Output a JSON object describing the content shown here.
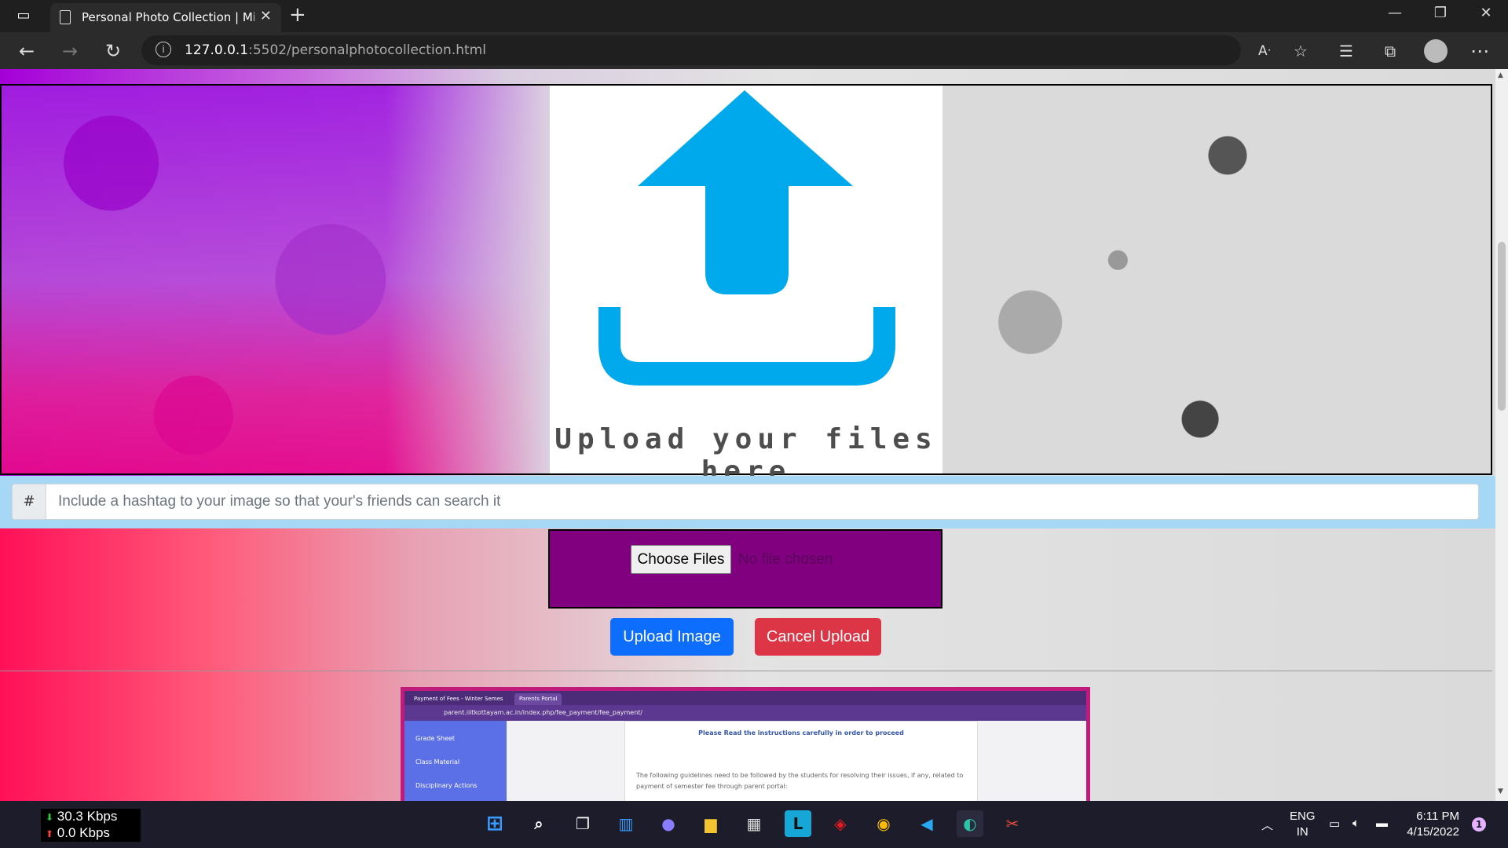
{
  "browser": {
    "tab_title": "Personal Photo Collection | Mini",
    "url_host": "127.0.0.1",
    "url_path": ":5502/personalphotocollection.html"
  },
  "banner": {
    "caption": "Upload your files here"
  },
  "hashtag": {
    "prefix": "#",
    "placeholder": "Include a hashtag to your image so that your's friends can search it"
  },
  "file_input": {
    "button_label": "Choose Files",
    "status": "No file chosen"
  },
  "actions": {
    "upload_label": "Upload Image",
    "cancel_label": "Cancel Upload"
  },
  "preview": {
    "tab1": "Payment of Fees - Winter Semes",
    "tab2": "Parents Portal",
    "url": "parent.iiitkottayam.ac.in/index.php/fee_payment/fee_payment/",
    "sidebar": [
      "Grade Sheet",
      "Class Material",
      "Disciplinary Actions"
    ],
    "heading": "Please Read the instructions carefully in order to proceed",
    "paragraph": "The following guidelines need to be followed by the students for resolving their issues, if any, related to payment of semester fee through parent portal:"
  },
  "taskbar": {
    "download_speed": "30.3 Kbps",
    "upload_speed": "0.0 Kbps",
    "language": "ENG",
    "region": "IN",
    "time": "6:11 PM",
    "date": "4/15/2022",
    "notification_count": "1"
  },
  "colors": {
    "primary": "#0d6efd",
    "danger": "#dc3545",
    "file_box": "#800080",
    "hash_row": "#a6d8f6",
    "upload_icon": "#00a8ec"
  }
}
